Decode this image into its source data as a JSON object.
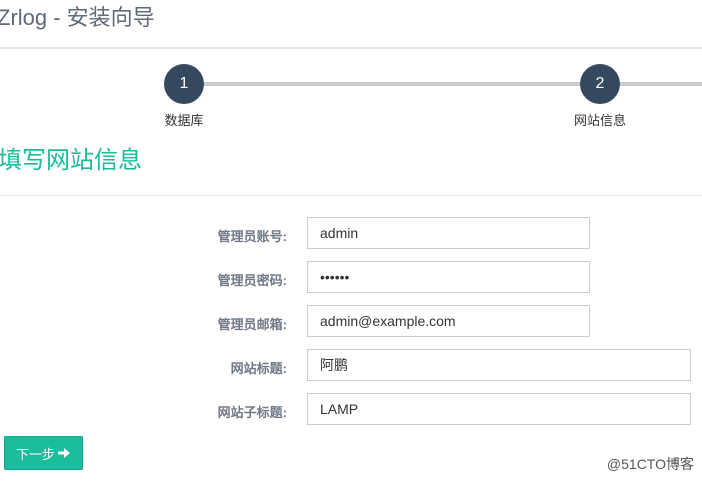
{
  "header": {
    "title": "Zrlog - 安装向导"
  },
  "stepper": {
    "steps": [
      {
        "number": "1",
        "label": "数据库"
      },
      {
        "number": "2",
        "label": "网站信息"
      }
    ]
  },
  "section": {
    "heading": "填写网站信息"
  },
  "form": {
    "admin_account": {
      "label": "管理员账号:",
      "value": "admin"
    },
    "admin_password": {
      "label": "管理员密码:",
      "value": "••••••"
    },
    "admin_email": {
      "label": "管理员邮箱:",
      "value": "admin@example.com"
    },
    "site_title": {
      "label": "网站标题:",
      "value": "阿鹏"
    },
    "site_subtitle": {
      "label": "网站子标题:",
      "value": "LAMP"
    }
  },
  "actions": {
    "next_label": "下一步"
  },
  "watermark": {
    "text": "@51CTO博客"
  },
  "colors": {
    "accent": "#1abc9c",
    "step_circle": "#34495e",
    "step_line": "#cccccc"
  }
}
